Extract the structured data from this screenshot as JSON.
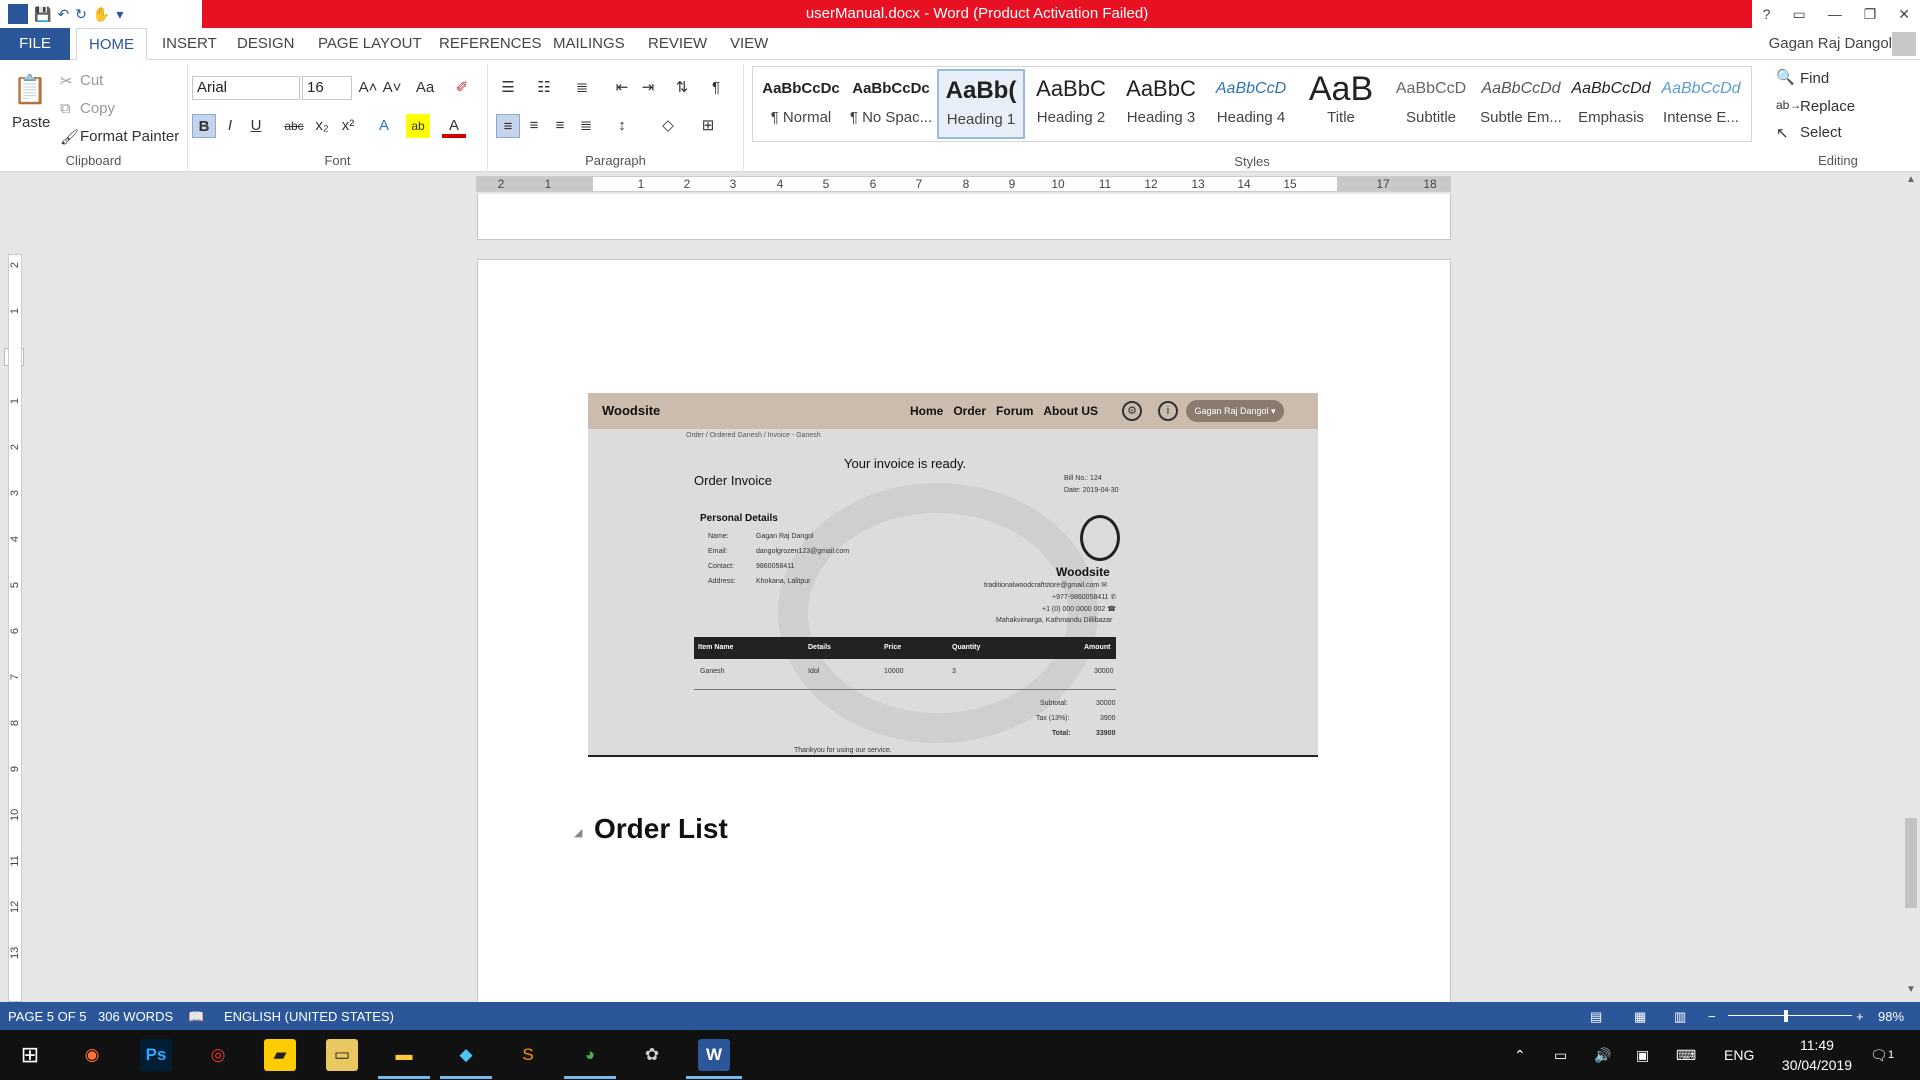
{
  "window": {
    "title": "userManual.docx -  Word (Product Activation Failed)",
    "controls": [
      "?",
      "▭",
      "—",
      "❐",
      "✕"
    ]
  },
  "qat": {
    "save": "💾",
    "undo": "↶",
    "redo": "↻",
    "touch": "✋",
    "customize": "▾"
  },
  "tabs": [
    "FILE",
    "HOME",
    "INSERT",
    "DESIGN",
    "PAGE LAYOUT",
    "REFERENCES",
    "MAILINGS",
    "REVIEW",
    "VIEW"
  ],
  "user": "Gagan Raj Dangol",
  "clipboard": {
    "paste": "Paste",
    "cut": "Cut",
    "copy": "Copy",
    "format_painter": "Format Painter",
    "label": "Clipboard"
  },
  "font": {
    "family": "Arial",
    "size": "16",
    "label": "Font",
    "bold": "B",
    "italic": "I",
    "underline": "U",
    "strike": "abc",
    "sub": "x₂",
    "sup": "x²",
    "grow": "A˄",
    "shrink": "A˅",
    "case": "Aa",
    "clear": "✐",
    "effects": "A",
    "highlight": "ab",
    "color": "A"
  },
  "paragraph": {
    "label": "Paragraph",
    "pilcrow": "¶"
  },
  "styles": {
    "label": "Styles",
    "items": [
      {
        "preview": "AaBbCcDc",
        "name": "¶ Normal"
      },
      {
        "preview": "AaBbCcDc",
        "name": "¶ No Spac..."
      },
      {
        "preview": "AaBb(",
        "name": "Heading 1"
      },
      {
        "preview": "AaBbC",
        "name": "Heading 2"
      },
      {
        "preview": "AaBbC",
        "name": "Heading 3"
      },
      {
        "preview": "AaBbCcD",
        "name": "Heading 4"
      },
      {
        "preview": "AaB",
        "name": "Title"
      },
      {
        "preview": "AaBbCcD",
        "name": "Subtitle"
      },
      {
        "preview": "AaBbCcDd",
        "name": "Subtle Em..."
      },
      {
        "preview": "AaBbCcDd",
        "name": "Emphasis"
      },
      {
        "preview": "AaBbCcDd",
        "name": "Intense E..."
      }
    ]
  },
  "editing": {
    "label": "Editing",
    "find": "Find",
    "replace": "Replace",
    "select": "Select"
  },
  "ruler": {
    "ticks": [
      "2",
      "1",
      "1",
      "1",
      "2",
      "3",
      "4",
      "5",
      "6",
      "7",
      "8",
      "9",
      "10",
      "11",
      "12",
      "13",
      "14",
      "15",
      "17",
      "18"
    ],
    "vticks": [
      "2",
      "1",
      "1",
      "1",
      "2",
      "3",
      "4",
      "5",
      "6",
      "7",
      "8",
      "9",
      "10",
      "11",
      "12",
      "13"
    ],
    "tab_selector": "L"
  },
  "document": {
    "heading": "Order List",
    "screenshot": {
      "brand": "Woodsite",
      "nav": [
        "Home",
        "Order",
        "Forum",
        "About US"
      ],
      "user_pill": "Gagan Raj Dangol ▾",
      "breadcrumb": "Order /  Ordered Ganesh /  Invoice - Ganesh",
      "ready": "Your invoice is ready.",
      "invoice_title": "Order Invoice",
      "bill_no": "Bill No.: 124",
      "date": "Date: 2019-04-30",
      "personal": "Personal Details",
      "name_label": "Name:",
      "name": "Gagan Raj Dangol",
      "email_label": "Email:",
      "email": "dangolgrozen123@gmail.com",
      "contact_label": "Contact:",
      "contact": "9860058411",
      "address_label": "Address:",
      "address": "Khokana, Lalitpur",
      "store_name": "Woodsite",
      "store_email": "traditionalwoodcraftstore@gmail.com ✉",
      "store_phone1": "+977-9860058411 ✆",
      "store_phone2": "+1 (0) 000 0000 002 ☎",
      "store_address": "Mahakvimarga, Kathmandu Dillibazar",
      "table_head": [
        "Item Name",
        "Details",
        "Price",
        "Quantity",
        "Amount"
      ],
      "table_row": [
        "Ganesh",
        "Idol",
        "10000",
        "3",
        "30000"
      ],
      "subtotal_label": "Subtotal:",
      "subtotal": "30000",
      "tax_label": "Tax (13%):",
      "tax": "3900",
      "total_label": "Total:",
      "total": "33900",
      "thanks": "Thankyou for using our service."
    }
  },
  "status": {
    "page": "PAGE 5 OF 5",
    "words": "306 WORDS",
    "language": "ENGLISH (UNITED STATES)",
    "zoom": "98%",
    "zoom_minus": "−",
    "zoom_plus": "+"
  },
  "taskbar": {
    "lang": "ENG",
    "time": "11:49",
    "date": "30/04/2019",
    "notif": "1"
  }
}
